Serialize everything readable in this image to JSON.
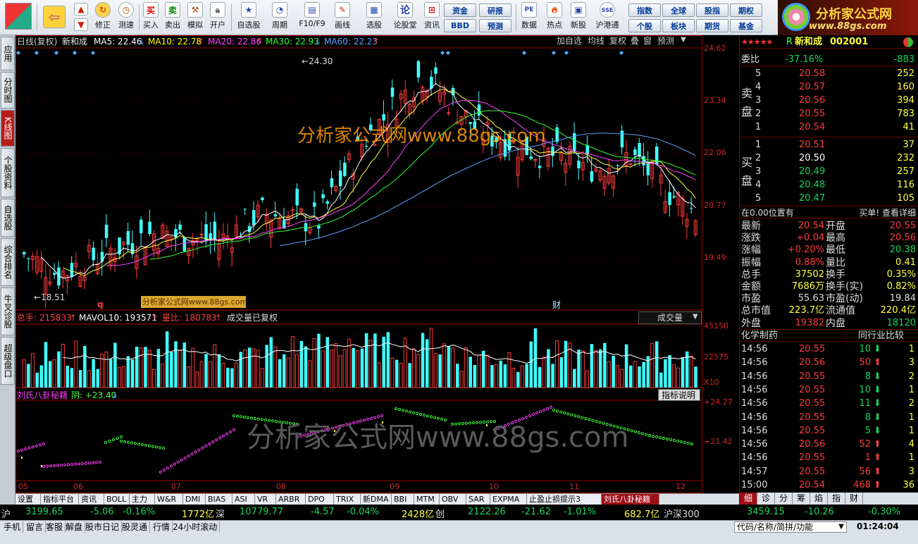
{
  "toolbar": {
    "buttons": [
      "",
      "修正",
      "测速",
      "买入",
      "卖出",
      "模拟",
      "开户",
      "自选股",
      "周期",
      "F10/F9",
      "画线",
      "选股",
      "论股堂",
      "资讯",
      "数据",
      "热点",
      "新股",
      "沪港通"
    ],
    "grid_buttons": [
      "资金",
      "研报",
      "BBD",
      "预测",
      "指数",
      "全球",
      "股指",
      "期权",
      "个股",
      "板块",
      "期货",
      "基金"
    ],
    "logo_text": "分析家公式网",
    "logo_url": "www.88gs.com"
  },
  "left_tabs": [
    "应用",
    "分时图",
    "K线图",
    "个股资料",
    "自选股",
    "综合排名",
    "牛叉诊股",
    "超级盘口"
  ],
  "chart": {
    "header": {
      "period": "日线(复权)",
      "stock": "新和成",
      "ma5": "MA5: 22.46",
      "ma10": "MA10: 22.78",
      "ma20": "MA20: 22.86",
      "ma30": "MA30: 22.93",
      "ma60": "MA60: 22.23",
      "ma5_arrow": "↓",
      "ma10_arrow": "↑",
      "ma20_arrow": "↑",
      "ma30_arrow": "↓",
      "ma60_arrow": "↑",
      "tools": [
        "加自选",
        "均线",
        "复权",
        "叠",
        "窗",
        "预测"
      ]
    },
    "price_axis": [
      "24.62",
      "23.34",
      "22.06",
      "20.77",
      "19.49"
    ],
    "high_label": "24.30",
    "low_label": "18.51",
    "watermark": "分析家公式网www.88gs.com",
    "big_watermark": "分析家公式网www.88gs.com",
    "small_watermark": "分析家公式网www.88gs.com",
    "marker_q": "q",
    "marker_cai": "财",
    "volume": {
      "total": "总手: 215833",
      "mavol": "MAVOL10: 193571",
      "ratio": "量比: 180783",
      "note": "成交量已复权",
      "dropdown": "成交量",
      "axis": [
        "45150",
        "22575",
        "X10"
      ],
      "total_arrow": "↑",
      "mavol_arrow": "↑",
      "ratio_arrow": "↑"
    },
    "indicator": {
      "name": "刘氏八卦秘籍",
      "value": "阴: +23.40",
      "value_arrow": "↓",
      "help": "指标说明",
      "axis": [
        "+24.27",
        "+21.42"
      ]
    },
    "months": [
      "05",
      "06",
      "07",
      "08",
      "09",
      "10",
      "11",
      "12"
    ]
  },
  "bottom_tabs": [
    "设置",
    "指标平台",
    "资讯",
    "BOLL",
    "主力",
    "W&R",
    "DMI",
    "BIAS",
    "ASI",
    "VR",
    "ARBR",
    "DPO",
    "TRIX",
    "新DMA",
    "BBI",
    "MTM",
    "OBV",
    "SAR",
    "EXPMA",
    "止盈止损提示3",
    "刘氏八卦秘籍"
  ],
  "right": {
    "title": "新和成",
    "code": "002001",
    "prefix": "R",
    "weibi_label": "委比",
    "weibi": "-37.16%",
    "weicha": "-883",
    "sell_label": [
      "卖",
      "盘"
    ],
    "buy_label": [
      "买",
      "盘"
    ],
    "sell": [
      {
        "n": "5",
        "p": "20.58",
        "v": "252"
      },
      {
        "n": "4",
        "p": "20.57",
        "v": "160"
      },
      {
        "n": "3",
        "p": "20.56",
        "v": "394"
      },
      {
        "n": "2",
        "p": "20.55",
        "v": "783"
      },
      {
        "n": "1",
        "p": "20.54",
        "v": "41"
      }
    ],
    "buy": [
      {
        "n": "1",
        "p": "20.51",
        "v": "37"
      },
      {
        "n": "2",
        "p": "20.50",
        "v": "232"
      },
      {
        "n": "3",
        "p": "20.49",
        "v": "257"
      },
      {
        "n": "4",
        "p": "20.48",
        "v": "116"
      },
      {
        "n": "5",
        "p": "20.47",
        "v": "105"
      }
    ],
    "pos_text": "在0.00位置有",
    "pos_right": "买单! 查看详细",
    "stats": [
      {
        "l1": "最新",
        "v1": "20.54",
        "l2": "开盘",
        "v2": "20.55"
      },
      {
        "l1": "涨跌",
        "v1": "+0.04",
        "l2": "最高",
        "v2": "20.56"
      },
      {
        "l1": "涨幅",
        "v1": "+0.20%",
        "l2": "最低",
        "v2": "20.38"
      },
      {
        "l1": "振幅",
        "v1": "0.88%",
        "l2": "量比",
        "v2": "0.41"
      },
      {
        "l1": "总手",
        "v1": "37502",
        "l2": "换手",
        "v2": "0.35%"
      },
      {
        "l1": "金额",
        "v1": "7686万",
        "l2": "换手(实)",
        "v2": "0.82%"
      },
      {
        "l1": "市盈",
        "v1": "55.63",
        "l2": "市盈(动)",
        "v2": "19.84"
      },
      {
        "l1": "总市值",
        "v1": "223.7亿",
        "l2": "流通值",
        "v2": "220.4亿"
      },
      {
        "l1": "外盘",
        "v1": "19382",
        "l2": "内盘",
        "v2": "18120"
      }
    ],
    "industry": "化学制药",
    "industry_cmp": "同行业比较",
    "ticks": [
      {
        "t": "14:56",
        "p": "20.55",
        "v": "10",
        "d": "dn",
        "n": "1"
      },
      {
        "t": "14:56",
        "p": "20.56",
        "v": "50",
        "d": "up",
        "n": "3"
      },
      {
        "t": "14:56",
        "p": "20.55",
        "v": "8",
        "d": "dn",
        "n": "2"
      },
      {
        "t": "14:56",
        "p": "20.55",
        "v": "10",
        "d": "dn",
        "n": "1"
      },
      {
        "t": "14:56",
        "p": "20.55",
        "v": "11",
        "d": "dn",
        "n": "2"
      },
      {
        "t": "14:56",
        "p": "20.55",
        "v": "8",
        "d": "dn",
        "n": "1"
      },
      {
        "t": "14:56",
        "p": "20.55",
        "v": "5",
        "d": "dn",
        "n": "1"
      },
      {
        "t": "14:56",
        "p": "20.56",
        "v": "52",
        "d": "up",
        "n": "4"
      },
      {
        "t": "14:56",
        "p": "20.55",
        "v": "1",
        "d": "up",
        "n": "1"
      },
      {
        "t": "14:57",
        "p": "20.55",
        "v": "56",
        "d": "up",
        "n": "3"
      },
      {
        "t": "15:00",
        "p": "20.54",
        "v": "468",
        "d": "up",
        "n": "36"
      }
    ],
    "tabs": [
      "细",
      "诊",
      "分",
      "筹",
      "焰",
      "指",
      "财"
    ]
  },
  "indexbar": {
    "sh_label": "沪",
    "sh": "3199.65",
    "sh_ch": "-5.06",
    "sh_pct": "-0.16%",
    "sh_amt": "1772亿",
    "sz_label": "深",
    "sz": "10779.77",
    "sz_ch": "-4.57",
    "sz_pct": "-0.04%",
    "sz_amt": "2428亿",
    "cy_label": "创",
    "cy": "2122.26",
    "cy_ch": "-21.62",
    "cy_pct": "-1.01%",
    "cy_amt": "682.7亿",
    "hs_label": "沪深300",
    "hs": "3459.15",
    "hs_ch": "-10.26",
    "hs_pct": "-0.30%"
  },
  "statusbar": {
    "items": [
      "手机",
      "留言",
      "客服",
      "解盘",
      "股市日记",
      "股灵通",
      "行情",
      "24小时滚动"
    ],
    "search_placeholder": "代码/名称/简拼/功能",
    "time": "01:24:04"
  },
  "colors": {
    "up": "#ff3b3b",
    "down": "#40ffff",
    "ma5": "#ffffff",
    "ma10": "#ffff00",
    "ma20": "#ff40ff",
    "ma30": "#30ff30",
    "ma60": "#5aa0ff"
  }
}
